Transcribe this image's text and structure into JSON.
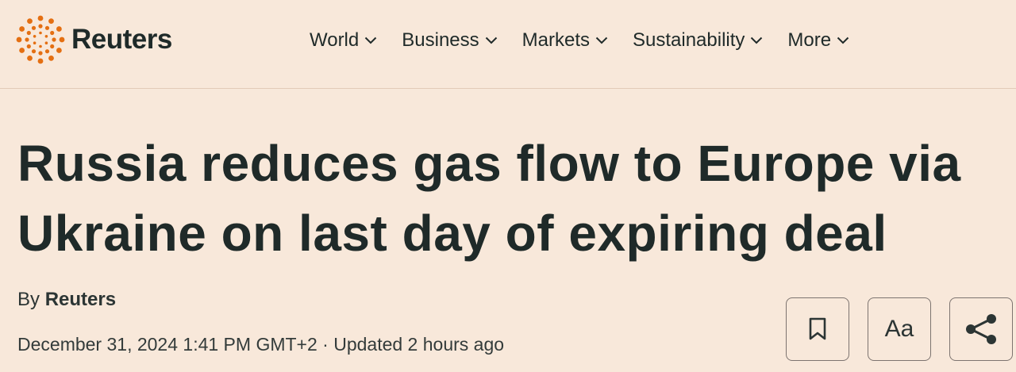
{
  "brand": {
    "name": "Reuters",
    "accent": "#e46f12"
  },
  "nav": {
    "items": [
      {
        "label": "World"
      },
      {
        "label": "Business"
      },
      {
        "label": "Markets"
      },
      {
        "label": "Sustainability"
      },
      {
        "label": "More"
      }
    ]
  },
  "article": {
    "headline_line1": "Russia reduces gas flow to Europe via",
    "headline_line2": "Ukraine on last day of expiring deal",
    "by_prefix": "By",
    "author": "Reuters",
    "dateline": "December 31, 2024 1:41 PM GMT+2 · Updated 2 hours ago"
  },
  "actions": {
    "bookmark_icon": "bookmark-icon",
    "text_size_label": "Aa",
    "share_icon": "share-icon"
  }
}
